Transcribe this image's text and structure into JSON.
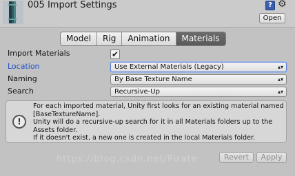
{
  "header": {
    "title": "005 Import Settings",
    "open_label": "Open",
    "help_glyph": "?",
    "icons": [
      "model-asset-icon",
      "help-icon",
      "gear-icon"
    ]
  },
  "tabs": [
    {
      "label": "Model",
      "active": false
    },
    {
      "label": "Rig",
      "active": false
    },
    {
      "label": "Animation",
      "active": false
    },
    {
      "label": "Materials",
      "active": true
    }
  ],
  "settings": {
    "import_materials": {
      "label": "Import Materials",
      "checked": true
    },
    "location": {
      "label": "Location",
      "value": "Use External Materials (Legacy)"
    },
    "naming": {
      "label": "Naming",
      "value": "By Base Texture Name"
    },
    "search": {
      "label": "Search",
      "value": "Recursive-Up"
    }
  },
  "info": {
    "text": "For each imported material, Unity first looks for an existing material named [BaseTextureName].\nUnity will do a recursive-up search for it in all Materials folders up to the Assets folder.\nIf it doesn't exist, a new one is created in the local Materials folder."
  },
  "footer": {
    "revert_label": "Revert",
    "apply_label": "Apply",
    "watermark": "https://blog.csdn.net/Pirate"
  },
  "colors": {
    "background": "#c2c2c2",
    "active_tab": "#5f5f5f",
    "location_label": "#1f4ec8"
  }
}
